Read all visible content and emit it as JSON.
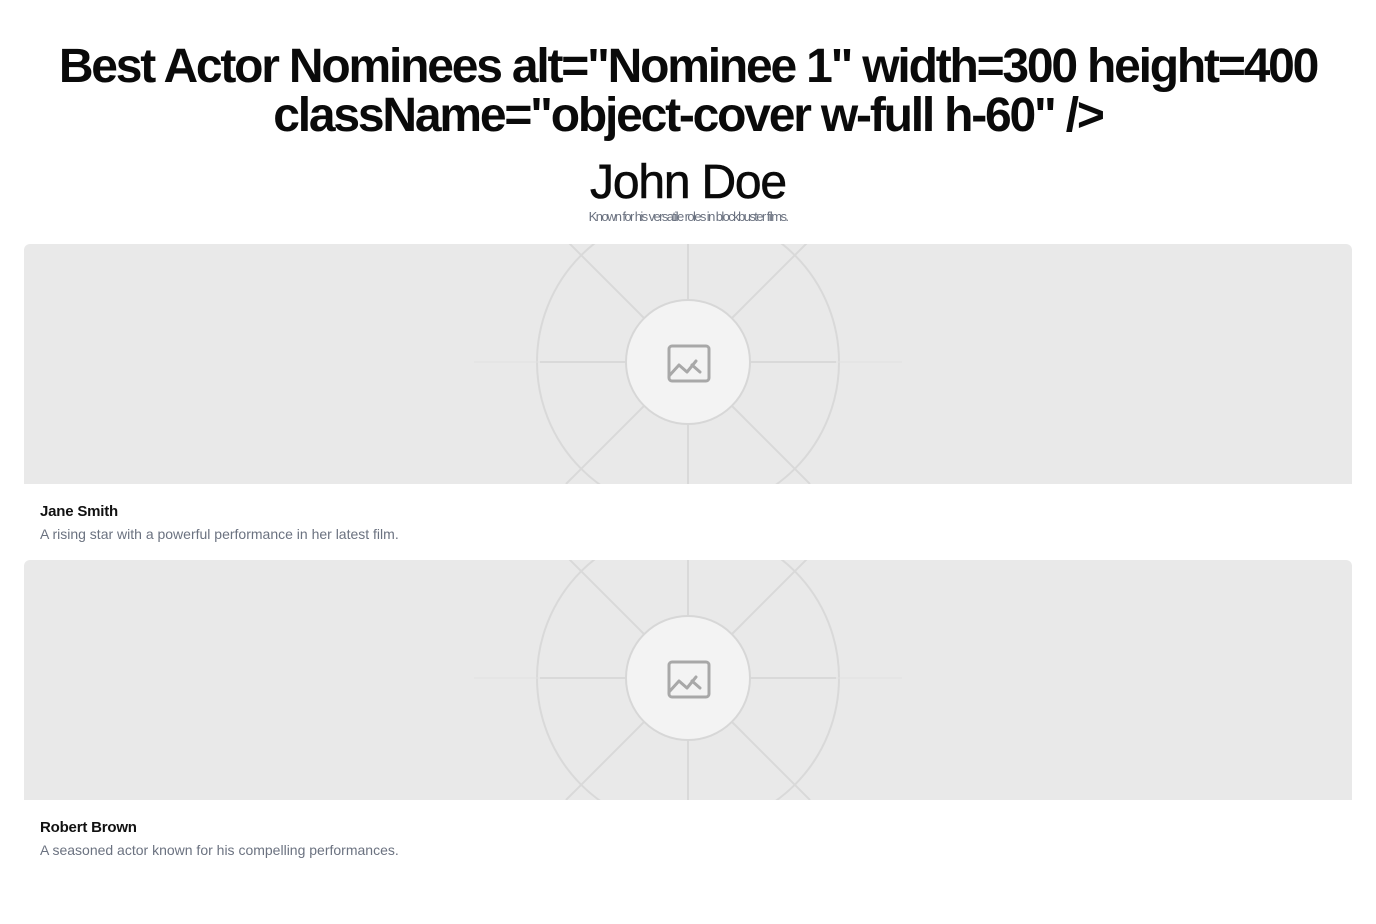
{
  "header": {
    "title": "Best Actor Nominees alt=\"Nominee 1\" width=300 height=400 className=\"object-cover w-full h-60\" />",
    "featured_name": "John Doe",
    "featured_description": "Known for his versatile roles in blockbuster films."
  },
  "nominees": [
    {
      "name": "Jane Smith",
      "description": "A rising star with a powerful performance in her latest film.",
      "image_icon": "image-placeholder-icon"
    },
    {
      "name": "Robert Brown",
      "description": "A seasoned actor known for his compelling performances.",
      "image_icon": "image-placeholder-icon"
    }
  ],
  "colors": {
    "placeholder_background": "#e9e9e9",
    "muted_text": "#6b7280",
    "heading_text": "#0a0a0a"
  }
}
